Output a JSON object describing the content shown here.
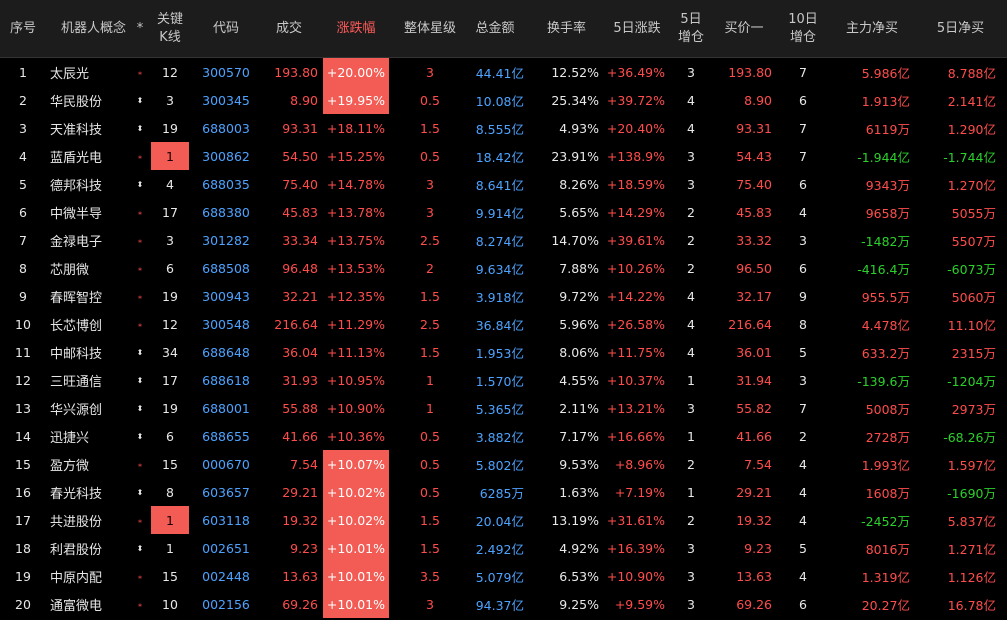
{
  "headers": [
    "序号",
    "机器人概念",
    "*",
    "关键\nK线",
    "代码",
    "成交",
    "涨跌幅",
    "整体星级",
    "总金额",
    "换手率",
    "5日涨跌",
    "5日\n增仓",
    "买价一",
    "10日\n增仓",
    "主力净买",
    "5日净买"
  ],
  "sort_column": "涨跌幅",
  "colors": {
    "up": "#ff4d4d",
    "down": "#2bd12b",
    "code": "#4da3ff",
    "highlight": "#f25c54"
  },
  "rows": [
    {
      "idx": "1",
      "name": "太辰光",
      "flag": "up",
      "k": "12",
      "k_hl": false,
      "code": "300570",
      "price": "193.80",
      "pct": "+20.00%",
      "pct_hl": true,
      "star": "3",
      "amount": "44.41亿",
      "turnover": "12.52%",
      "d5": "+36.49%",
      "add5": "3",
      "bid": "193.80",
      "add10": "7",
      "main": "5.986亿",
      "main_dir": "up",
      "net5": "8.788亿",
      "net5_dir": "up"
    },
    {
      "idx": "2",
      "name": "华民股份",
      "flag": "both",
      "k": "3",
      "k_hl": false,
      "code": "300345",
      "price": "8.90",
      "pct": "+19.95%",
      "pct_hl": true,
      "star": "0.5",
      "amount": "10.08亿",
      "turnover": "25.34%",
      "d5": "+39.72%",
      "add5": "4",
      "bid": "8.90",
      "add10": "6",
      "main": "1.913亿",
      "main_dir": "up",
      "net5": "2.141亿",
      "net5_dir": "up"
    },
    {
      "idx": "3",
      "name": "天准科技",
      "flag": "both",
      "k": "19",
      "k_hl": false,
      "code": "688003",
      "price": "93.31",
      "pct": "+18.11%",
      "pct_hl": false,
      "star": "1.5",
      "amount": "8.555亿",
      "turnover": "4.93%",
      "d5": "+20.40%",
      "add5": "4",
      "bid": "93.31",
      "add10": "7",
      "main": "6119万",
      "main_dir": "up",
      "net5": "1.290亿",
      "net5_dir": "up"
    },
    {
      "idx": "4",
      "name": "蓝盾光电",
      "flag": "up",
      "k": "1",
      "k_hl": true,
      "code": "300862",
      "price": "54.50",
      "pct": "+15.25%",
      "pct_hl": false,
      "star": "0.5",
      "amount": "18.42亿",
      "turnover": "23.91%",
      "d5": "+138.9%",
      "add5": "3",
      "bid": "54.43",
      "add10": "7",
      "main": "-1.944亿",
      "main_dir": "down",
      "net5": "-1.744亿",
      "net5_dir": "down"
    },
    {
      "idx": "5",
      "name": "德邦科技",
      "flag": "both",
      "k": "4",
      "k_hl": false,
      "code": "688035",
      "price": "75.40",
      "pct": "+14.78%",
      "pct_hl": false,
      "star": "3",
      "amount": "8.641亿",
      "turnover": "8.26%",
      "d5": "+18.59%",
      "add5": "3",
      "bid": "75.40",
      "add10": "6",
      "main": "9343万",
      "main_dir": "up",
      "net5": "1.270亿",
      "net5_dir": "up"
    },
    {
      "idx": "6",
      "name": "中微半导",
      "flag": "up",
      "k": "17",
      "k_hl": false,
      "code": "688380",
      "price": "45.83",
      "pct": "+13.78%",
      "pct_hl": false,
      "star": "3",
      "amount": "9.914亿",
      "turnover": "5.65%",
      "d5": "+14.29%",
      "add5": "2",
      "bid": "45.83",
      "add10": "4",
      "main": "9658万",
      "main_dir": "up",
      "net5": "5055万",
      "net5_dir": "up"
    },
    {
      "idx": "7",
      "name": "金禄电子",
      "flag": "up",
      "k": "3",
      "k_hl": false,
      "code": "301282",
      "price": "33.34",
      "pct": "+13.75%",
      "pct_hl": false,
      "star": "2.5",
      "amount": "8.274亿",
      "turnover": "14.70%",
      "d5": "+39.61%",
      "add5": "2",
      "bid": "33.32",
      "add10": "3",
      "main": "-1482万",
      "main_dir": "down",
      "net5": "5507万",
      "net5_dir": "up"
    },
    {
      "idx": "8",
      "name": "芯朋微",
      "flag": "up",
      "k": "6",
      "k_hl": false,
      "code": "688508",
      "price": "96.48",
      "pct": "+13.53%",
      "pct_hl": false,
      "star": "2",
      "amount": "9.634亿",
      "turnover": "7.88%",
      "d5": "+10.26%",
      "add5": "2",
      "bid": "96.50",
      "add10": "6",
      "main": "-416.4万",
      "main_dir": "down",
      "net5": "-6073万",
      "net5_dir": "down"
    },
    {
      "idx": "9",
      "name": "春晖智控",
      "flag": "up",
      "k": "19",
      "k_hl": false,
      "code": "300943",
      "price": "32.21",
      "pct": "+12.35%",
      "pct_hl": false,
      "star": "1.5",
      "amount": "3.918亿",
      "turnover": "9.72%",
      "d5": "+14.22%",
      "add5": "4",
      "bid": "32.17",
      "add10": "9",
      "main": "955.5万",
      "main_dir": "up",
      "net5": "5060万",
      "net5_dir": "up"
    },
    {
      "idx": "10",
      "name": "长芯博创",
      "flag": "up",
      "k": "12",
      "k_hl": false,
      "code": "300548",
      "price": "216.64",
      "pct": "+11.29%",
      "pct_hl": false,
      "star": "2.5",
      "amount": "36.84亿",
      "turnover": "5.96%",
      "d5": "+26.58%",
      "add5": "4",
      "bid": "216.64",
      "add10": "8",
      "main": "4.478亿",
      "main_dir": "up",
      "net5": "11.10亿",
      "net5_dir": "up"
    },
    {
      "idx": "11",
      "name": "中邮科技",
      "flag": "both",
      "k": "34",
      "k_hl": false,
      "code": "688648",
      "price": "36.04",
      "pct": "+11.13%",
      "pct_hl": false,
      "star": "1.5",
      "amount": "1.953亿",
      "turnover": "8.06%",
      "d5": "+11.75%",
      "add5": "4",
      "bid": "36.01",
      "add10": "5",
      "main": "633.2万",
      "main_dir": "up",
      "net5": "2315万",
      "net5_dir": "up"
    },
    {
      "idx": "12",
      "name": "三旺通信",
      "flag": "both",
      "k": "17",
      "k_hl": false,
      "code": "688618",
      "price": "31.93",
      "pct": "+10.95%",
      "pct_hl": false,
      "star": "1",
      "amount": "1.570亿",
      "turnover": "4.55%",
      "d5": "+10.37%",
      "add5": "1",
      "bid": "31.94",
      "add10": "3",
      "main": "-139.6万",
      "main_dir": "down",
      "net5": "-1204万",
      "net5_dir": "down"
    },
    {
      "idx": "13",
      "name": "华兴源创",
      "flag": "both",
      "k": "19",
      "k_hl": false,
      "code": "688001",
      "price": "55.88",
      "pct": "+10.90%",
      "pct_hl": false,
      "star": "1",
      "amount": "5.365亿",
      "turnover": "2.11%",
      "d5": "+13.21%",
      "add5": "3",
      "bid": "55.82",
      "add10": "7",
      "main": "5008万",
      "main_dir": "up",
      "net5": "2973万",
      "net5_dir": "up"
    },
    {
      "idx": "14",
      "name": "迅捷兴",
      "flag": "both",
      "k": "6",
      "k_hl": false,
      "code": "688655",
      "price": "41.66",
      "pct": "+10.36%",
      "pct_hl": false,
      "star": "0.5",
      "amount": "3.882亿",
      "turnover": "7.17%",
      "d5": "+16.66%",
      "add5": "1",
      "bid": "41.66",
      "add10": "2",
      "main": "2728万",
      "main_dir": "up",
      "net5": "-68.26万",
      "net5_dir": "down"
    },
    {
      "idx": "15",
      "name": "盈方微",
      "flag": "up",
      "k": "15",
      "k_hl": false,
      "code": "000670",
      "price": "7.54",
      "pct": "+10.07%",
      "pct_hl": true,
      "star": "0.5",
      "amount": "5.802亿",
      "turnover": "9.53%",
      "d5": "+8.96%",
      "add5": "2",
      "bid": "7.54",
      "add10": "4",
      "main": "1.993亿",
      "main_dir": "up",
      "net5": "1.597亿",
      "net5_dir": "up"
    },
    {
      "idx": "16",
      "name": "春光科技",
      "flag": "both",
      "k": "8",
      "k_hl": false,
      "code": "603657",
      "price": "29.21",
      "pct": "+10.02%",
      "pct_hl": true,
      "star": "0.5",
      "amount": "6285万",
      "turnover": "1.63%",
      "d5": "+7.19%",
      "add5": "1",
      "bid": "29.21",
      "add10": "4",
      "main": "1608万",
      "main_dir": "up",
      "net5": "-1690万",
      "net5_dir": "down"
    },
    {
      "idx": "17",
      "name": "共进股份",
      "flag": "up",
      "k": "1",
      "k_hl": true,
      "code": "603118",
      "price": "19.32",
      "pct": "+10.02%",
      "pct_hl": true,
      "star": "1.5",
      "amount": "20.04亿",
      "turnover": "13.19%",
      "d5": "+31.61%",
      "add5": "2",
      "bid": "19.32",
      "add10": "4",
      "main": "-2452万",
      "main_dir": "down",
      "net5": "5.837亿",
      "net5_dir": "up"
    },
    {
      "idx": "18",
      "name": "利君股份",
      "flag": "both",
      "k": "1",
      "k_hl": false,
      "code": "002651",
      "price": "9.23",
      "pct": "+10.01%",
      "pct_hl": true,
      "star": "1.5",
      "amount": "2.492亿",
      "turnover": "4.92%",
      "d5": "+16.39%",
      "add5": "3",
      "bid": "9.23",
      "add10": "5",
      "main": "8016万",
      "main_dir": "up",
      "net5": "1.271亿",
      "net5_dir": "up"
    },
    {
      "idx": "19",
      "name": "中原内配",
      "flag": "up",
      "k": "15",
      "k_hl": false,
      "code": "002448",
      "price": "13.63",
      "pct": "+10.01%",
      "pct_hl": true,
      "star": "3.5",
      "amount": "5.079亿",
      "turnover": "6.53%",
      "d5": "+10.90%",
      "add5": "3",
      "bid": "13.63",
      "add10": "4",
      "main": "1.319亿",
      "main_dir": "up",
      "net5": "1.126亿",
      "net5_dir": "up"
    },
    {
      "idx": "20",
      "name": "通富微电",
      "flag": "up",
      "k": "10",
      "k_hl": false,
      "code": "002156",
      "price": "69.26",
      "pct": "+10.01%",
      "pct_hl": true,
      "star": "3",
      "amount": "94.37亿",
      "turnover": "9.25%",
      "d5": "+9.59%",
      "add5": "3",
      "bid": "69.26",
      "add10": "6",
      "main": "20.27亿",
      "main_dir": "up",
      "net5": "16.78亿",
      "net5_dir": "up"
    }
  ]
}
